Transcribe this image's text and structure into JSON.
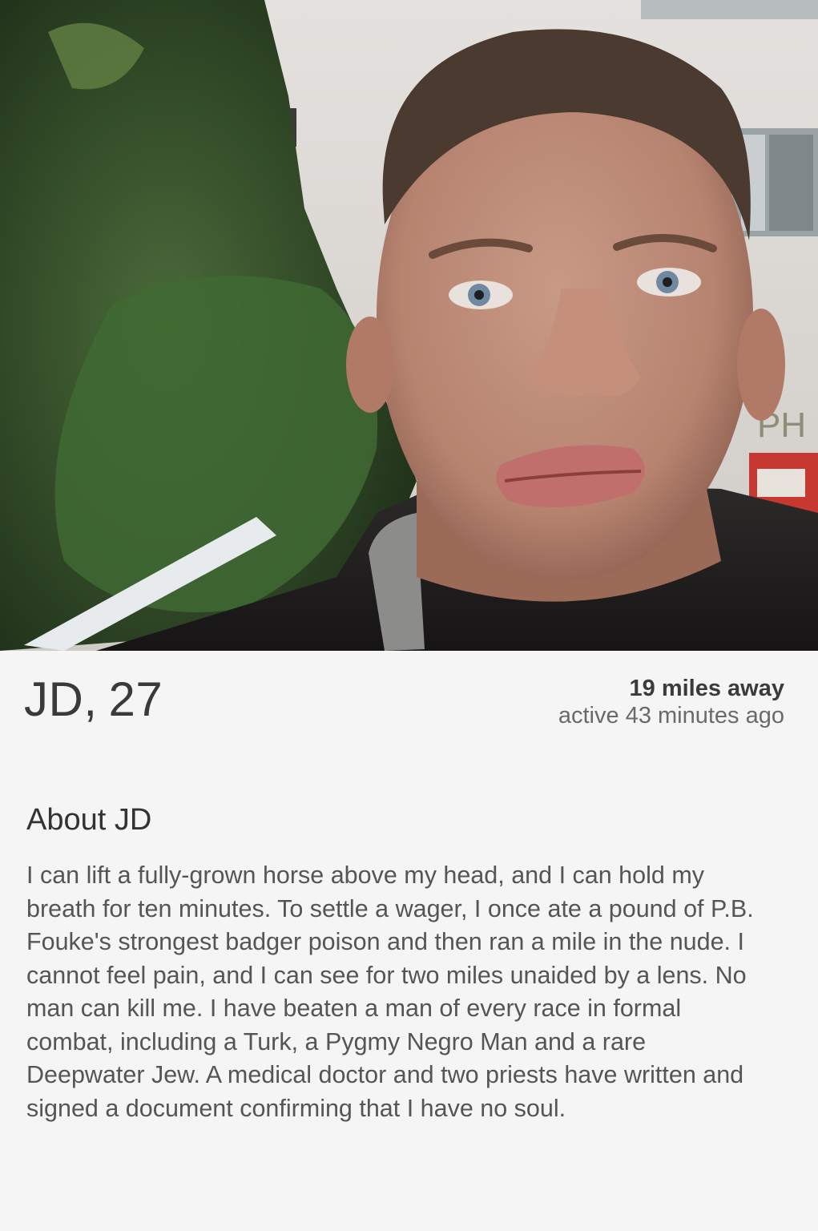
{
  "profile": {
    "name": "JD",
    "comma": ",",
    "age": "27",
    "distance": "19 miles away",
    "active": "active 43 minutes ago"
  },
  "about": {
    "title": "About JD",
    "bio": "I can lift a fully-grown horse above my head, and I can hold my breath for ten minutes. To settle a wager, I once ate a pound of P.B. Fouke's strongest badger poison and then ran a mile in the nude. I cannot feel pain, and I can see for two miles unaided by a lens. No man can kill me. I have beaten a man of every race in formal combat, including a Turk, a Pygmy Negro Man and a rare Deepwater Jew. A medical doctor and two priests have written and signed a document confirming that I have no soul."
  },
  "photo": {
    "graffiti_text": "PH"
  }
}
